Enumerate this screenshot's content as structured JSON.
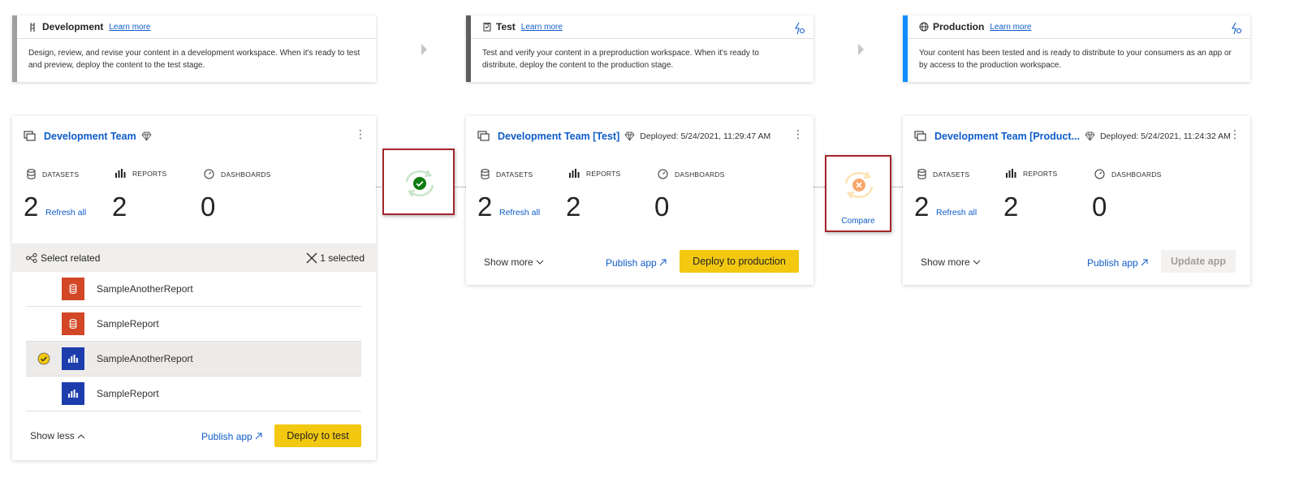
{
  "stages": [
    {
      "name": "Development",
      "learn_more": "Learn more",
      "description_l1": "Design, review, and revise your content in a development workspace. When it's ready to test",
      "description_l2": "and preview, deploy the content to the test stage."
    },
    {
      "name": "Test",
      "learn_more": "Learn more",
      "description_l1": "Test and verify your content in a preproduction workspace. When it's ready to",
      "description_l2": "distribute, deploy the content to the production stage."
    },
    {
      "name": "Production",
      "learn_more": "Learn more",
      "description_l1": "Your content has been tested and is ready to distribute to your consumers as an app or",
      "description_l2": "by access to the production workspace."
    }
  ],
  "colors": {
    "accent_blue": "#0f5cc9",
    "deploy_yellow": "#f2c811",
    "success_green": "#107c10",
    "warning_orange": "#f7a86b",
    "highlight_red": "#a4262c",
    "production_blue": "#118dff"
  },
  "workspaces": [
    {
      "title": "Development Team",
      "deployed": "",
      "labels": {
        "datasets": "DATASETS",
        "reports": "REPORTS",
        "dashboards": "DASHBOARDS"
      },
      "counts": {
        "datasets": "2",
        "reports": "2",
        "dashboards": "0"
      },
      "refresh": "Refresh all",
      "show_toggle": "Show less",
      "publish": "Publish app",
      "action": "Deploy to test"
    },
    {
      "title": "Development Team [Test]",
      "deployed": "Deployed: 5/24/2021, 11:29:47 AM",
      "labels": {
        "datasets": "DATASETS",
        "reports": "REPORTS",
        "dashboards": "DASHBOARDS"
      },
      "counts": {
        "datasets": "2",
        "reports": "2",
        "dashboards": "0"
      },
      "refresh": "Refresh all",
      "show_toggle": "Show more",
      "publish": "Publish app",
      "action": "Deploy to production"
    },
    {
      "title": "Development Team [Product...",
      "deployed": "Deployed: 5/24/2021, 11:24:32 AM",
      "labels": {
        "datasets": "DATASETS",
        "reports": "REPORTS",
        "dashboards": "DASHBOARDS"
      },
      "counts": {
        "datasets": "2",
        "reports": "2",
        "dashboards": "0"
      },
      "refresh": "Refresh all",
      "show_toggle": "Show more",
      "publish": "Publish app",
      "action": "Update app"
    }
  ],
  "related": {
    "label": "Select related",
    "selected": "1 selected"
  },
  "items": [
    {
      "name": "SampleAnotherReport",
      "type": "dataset",
      "selected": false
    },
    {
      "name": "SampleReport",
      "type": "dataset",
      "selected": false
    },
    {
      "name": "SampleAnotherReport",
      "type": "report",
      "selected": true
    },
    {
      "name": "SampleReport",
      "type": "report",
      "selected": false
    }
  ],
  "compare": {
    "label": "Compare"
  }
}
